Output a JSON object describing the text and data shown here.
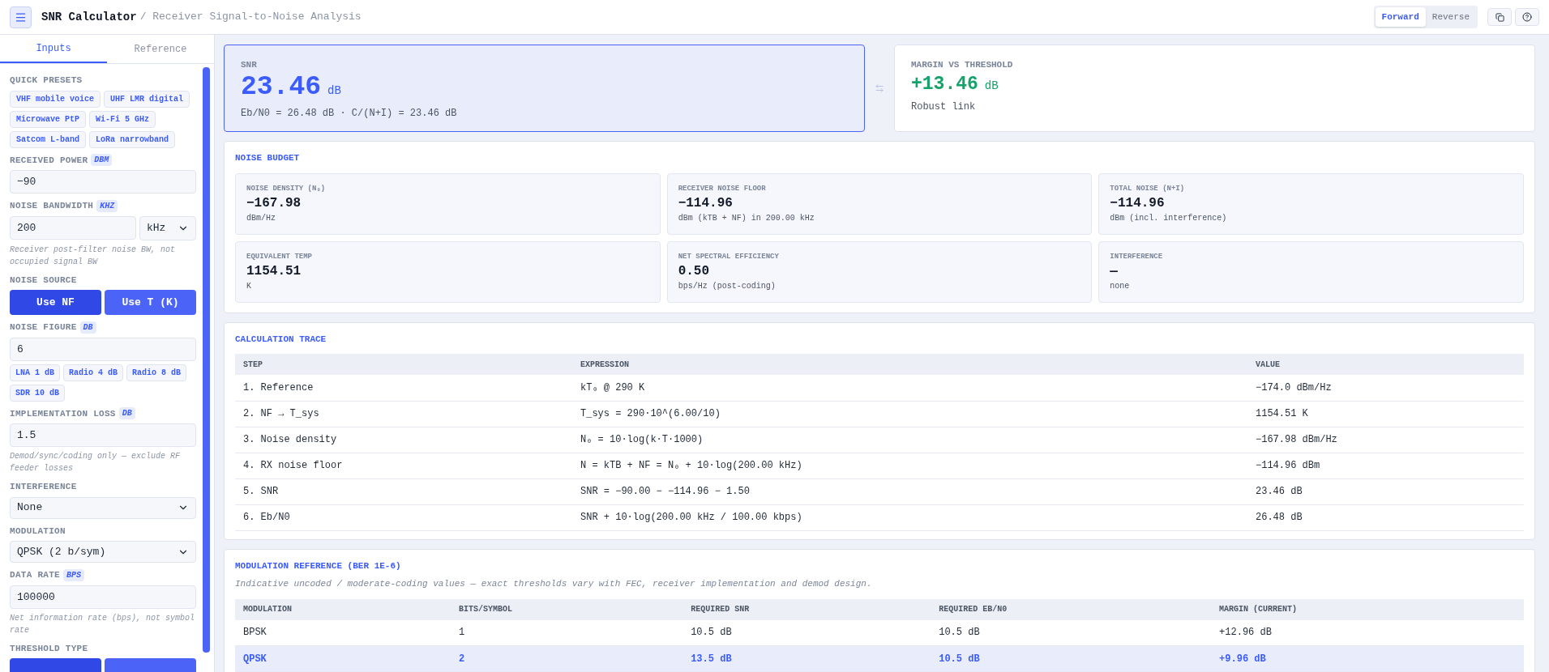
{
  "header": {
    "title": "SNR Calculator",
    "subtitle": "/ Receiver Signal-to-Noise Analysis",
    "direction_tabs": [
      {
        "label": "Forward",
        "selected": true
      },
      {
        "label": "Reverse",
        "selected": false
      }
    ]
  },
  "sidebar": {
    "tabs": [
      {
        "label": "Inputs",
        "selected": true
      },
      {
        "label": "Reference",
        "selected": false
      }
    ],
    "sections": [
      {
        "kind": "presets",
        "label": "QUICK PRESETS",
        "items": [
          "VHF mobile voice",
          "UHF LMR digital",
          "Microwave PtP",
          "Wi-Fi 5 GHz",
          "Satcom L-band",
          "LoRa narrowband"
        ]
      },
      {
        "kind": "input",
        "label": "RECEIVED POWER",
        "unit": "DBM",
        "value": "−90"
      },
      {
        "kind": "input",
        "label": "NOISE BANDWIDTH",
        "unit": "KHZ",
        "value": "200",
        "unit_select": "kHz",
        "hint": "Receiver post-filter noise BW, not occupied signal BW"
      },
      {
        "kind": "toggle",
        "label": "NOISE SOURCE",
        "options": [
          {
            "label": "Use NF",
            "selected": true
          },
          {
            "label": "Use T (K)",
            "selected": false
          }
        ]
      },
      {
        "kind": "input",
        "label": "NOISE FIGURE",
        "unit": "DB",
        "value": "6",
        "presets": [
          "LNA 1 dB",
          "Radio 4 dB",
          "Radio 8 dB",
          "SDR 10 dB"
        ]
      },
      {
        "kind": "input",
        "label": "IMPLEMENTATION LOSS",
        "unit": "DB",
        "value": "1.5",
        "hint": "Demod/sync/coding only — exclude RF feeder losses"
      },
      {
        "kind": "select",
        "label": "INTERFERENCE",
        "value": "None"
      },
      {
        "kind": "select",
        "label": "MODULATION",
        "value": "QPSK (2 b/sym)"
      },
      {
        "kind": "input",
        "label": "DATA RATE",
        "unit": "BPS",
        "value": "100000",
        "hint": "Net information rate (bps), not symbol rate"
      },
      {
        "kind": "toggle",
        "label": "THRESHOLD TYPE",
        "options": [
          {
            "selected": true
          },
          {
            "selected": false
          }
        ]
      }
    ]
  },
  "snr_card": {
    "label": "SNR",
    "value": "23.46",
    "unit": "dB",
    "detail": "Eb/N0 = 26.48 dB · C/(N+I) = 23.46 dB"
  },
  "margin_card": {
    "label": "MARGIN VS THRESHOLD",
    "value": "+13.46",
    "unit": "dB",
    "status": "Robust link"
  },
  "noise_budget": {
    "title": "NOISE BUDGET",
    "metrics": [
      {
        "label": "NOISE DENSITY (N₀)",
        "value": "−167.98",
        "unit": "dBm/Hz"
      },
      {
        "label": "RECEIVER NOISE FLOOR",
        "value": "−114.96",
        "unit": "dBm (kTB + NF) in 200.00 kHz"
      },
      {
        "label": "TOTAL NOISE (N+I)",
        "value": "−114.96",
        "unit": "dBm (incl. interference)"
      },
      {
        "label": "EQUIVALENT TEMP",
        "value": "1154.51",
        "unit": "K"
      },
      {
        "label": "NET SPECTRAL EFFICIENCY",
        "value": "0.50",
        "unit": "bps/Hz (post-coding)"
      },
      {
        "label": "INTERFERENCE",
        "value": "—",
        "unit": "none"
      }
    ]
  },
  "trace": {
    "title": "CALCULATION TRACE",
    "columns": [
      "STEP",
      "EXPRESSION",
      "VALUE"
    ],
    "rows": [
      [
        "1. Reference",
        "kT₀ @ 290 K",
        "−174.0 dBm/Hz"
      ],
      [
        "2. NF → T_sys",
        "T_sys = 290·10^(6.00/10)",
        "1154.51 K"
      ],
      [
        "3. Noise density",
        "N₀ = 10·log(k·T·1000)",
        "−167.98 dBm/Hz"
      ],
      [
        "4. RX noise floor",
        "N = kTB + NF = N₀ + 10·log(200.00 kHz)",
        "−114.96 dBm"
      ],
      [
        "5. SNR",
        "SNR = −90.00 − −114.96 − 1.50",
        "23.46 dB"
      ],
      [
        "6. Eb/N0",
        "SNR + 10·log(200.00 kHz / 100.00 kbps)",
        "26.48 dB"
      ]
    ]
  },
  "modulation_reference": {
    "title": "MODULATION REFERENCE (BER 1E-6)",
    "note": "Indicative uncoded / moderate-coding values — exact thresholds vary with FEC, receiver implementation and demod design.",
    "columns": [
      "MODULATION",
      "BITS/SYMBOL",
      "REQUIRED SNR",
      "REQUIRED EB/N0",
      "MARGIN (CURRENT)"
    ],
    "rows": [
      {
        "cells": [
          "BPSK",
          "1",
          "10.5 dB",
          "10.5 dB",
          "+12.96 dB"
        ],
        "selected": false
      },
      {
        "cells": [
          "QPSK",
          "2",
          "13.5 dB",
          "10.5 dB",
          "+9.96 dB"
        ],
        "selected": true
      }
    ]
  }
}
